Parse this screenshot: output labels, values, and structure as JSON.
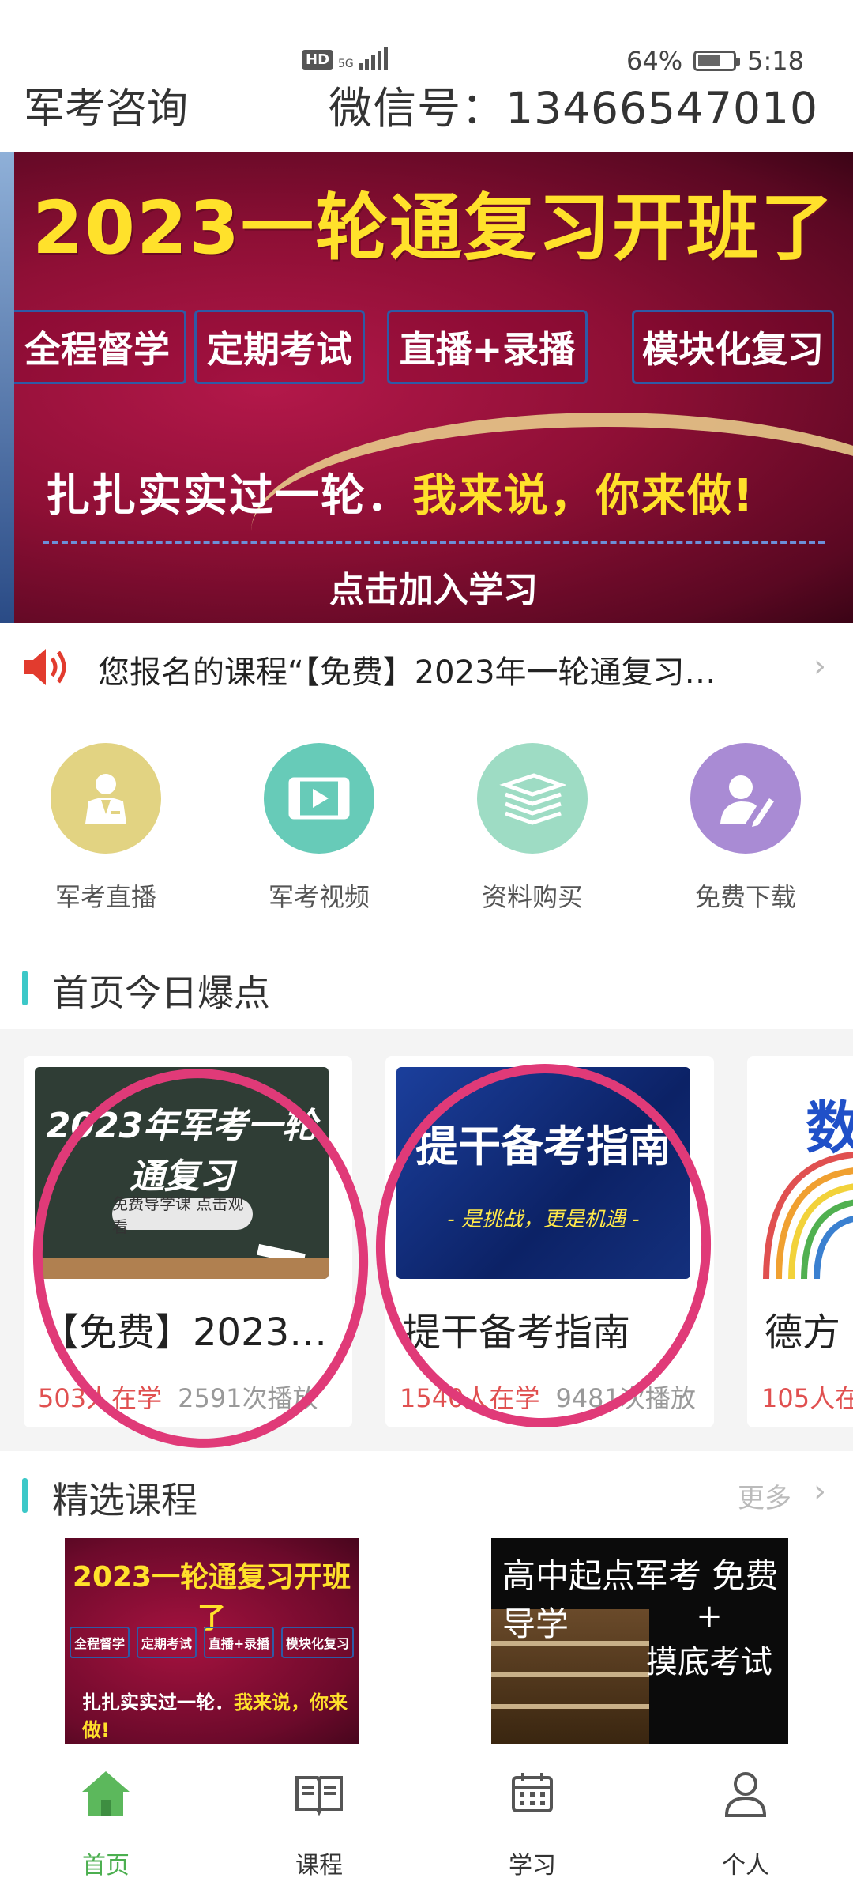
{
  "status_bar": {
    "network_hd": "HD",
    "network_gen": "5G",
    "battery": "64%",
    "battery_level": 0.64,
    "time": "5:18"
  },
  "header": {
    "title": "军考咨询",
    "contact": "微信号：13466547010"
  },
  "banner": {
    "title": "2023一轮通复习开班了",
    "tags": [
      "全程督学",
      "定期考试",
      "直播+录播",
      "模块化复习"
    ],
    "slogan_white": "扎扎实实过一轮．",
    "slogan_yellow": "我来说，你来做!",
    "cta": "点击加入学习"
  },
  "notice": {
    "text": "您报名的课程“【免费】2023年一轮通复习…"
  },
  "quick_links": [
    {
      "label": "军考直播",
      "icon": "teacher-icon",
      "color": "#e2d382"
    },
    {
      "label": "军考视频",
      "icon": "film-icon",
      "color": "#67cbb8"
    },
    {
      "label": "资料购买",
      "icon": "books-icon",
      "color": "#9edcc4"
    },
    {
      "label": "免费下载",
      "icon": "user-edit-icon",
      "color": "#a98bd4"
    }
  ],
  "hot_section": {
    "title": "首页今日爆点",
    "cards": [
      {
        "thumb_title": "2023年军考一轮通复习",
        "thumb_sub": "免费导学课 点击观看",
        "title": "【免费】2023…",
        "learners": "503人在学",
        "plays": "2591次播放"
      },
      {
        "thumb_title": "提干备考指南",
        "thumb_sub": "- 是挑战，更是机遇 -",
        "title": "提干备考指南",
        "learners": "1540人在学",
        "plays": "9481次播放"
      },
      {
        "thumb_title": "数",
        "title": "德方",
        "learners": "105人在",
        "plays": ""
      }
    ]
  },
  "featured": {
    "title": "精选课程",
    "more": "更多",
    "left": {
      "title": "2023一轮通复习开班了",
      "tags": [
        "全程督学",
        "定期考试",
        "直播+录播",
        "模块化复习"
      ],
      "slogan_white": "扎扎实实过一轮．",
      "slogan_yellow": "我来说，你来做!"
    },
    "right": {
      "line1": "高中起点军考  免费导学",
      "line2": "+",
      "line3": "摸底考试"
    }
  },
  "bottom_nav": [
    {
      "label": "首页",
      "active": true
    },
    {
      "label": "课程",
      "active": false
    },
    {
      "label": "学习",
      "active": false
    },
    {
      "label": "个人",
      "active": false
    }
  ],
  "colors": {
    "accent_green": "#4caf50",
    "section_bar": "#3cc8c8",
    "learners_red": "#e05050",
    "circle_marker": "#e03a78"
  }
}
